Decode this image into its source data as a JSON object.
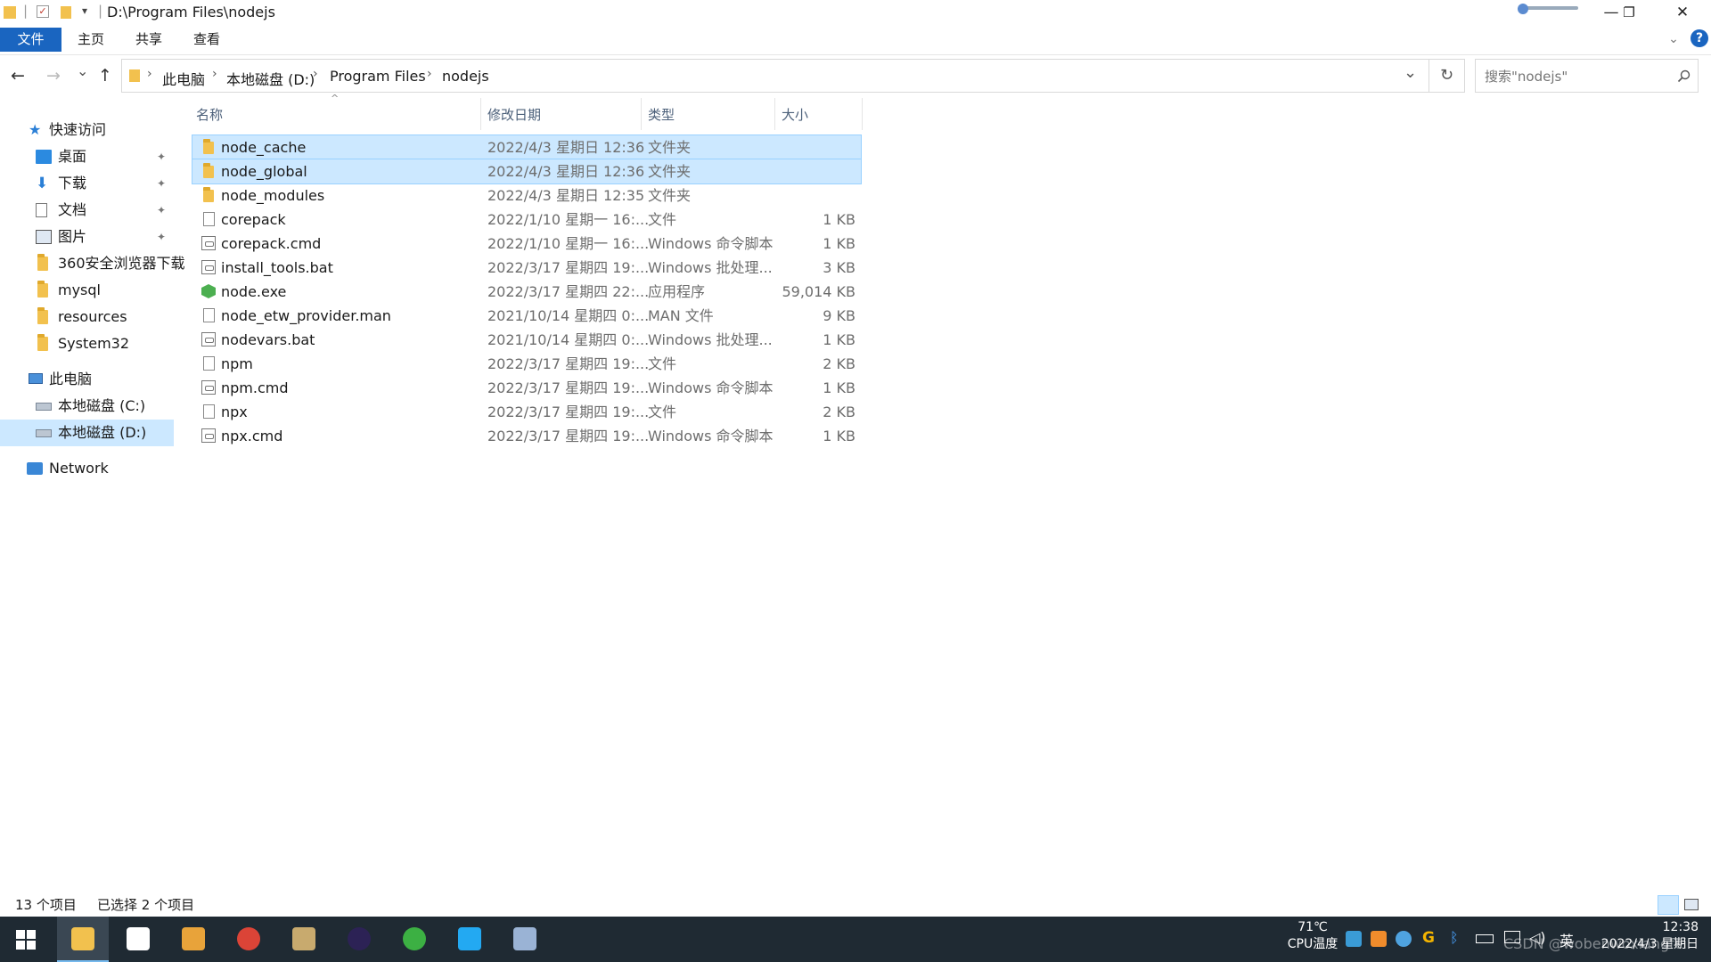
{
  "window": {
    "title": "D:\\Program Files\\nodejs",
    "controls": {
      "minimize": "—",
      "restore": "❐",
      "close": "✕"
    }
  },
  "ribbon": {
    "tabs": [
      "文件",
      "主页",
      "共享",
      "查看"
    ],
    "expand_icon": "chevron-down-icon",
    "help": "?"
  },
  "nav_buttons": {
    "back": "←",
    "forward": "→",
    "recent": "⌄",
    "up": "↑"
  },
  "address": {
    "crumbs": [
      "此电脑",
      "本地磁盘 (D:)",
      "Program Files",
      "nodejs"
    ],
    "separator": "›",
    "dropdown": "⌄",
    "refresh": "↻"
  },
  "search": {
    "placeholder": "搜索\"nodejs\"",
    "icon": "search-icon"
  },
  "navpane": {
    "quick_access": {
      "label": "快速访问",
      "items": [
        {
          "label": "桌面",
          "pinned": true,
          "icon": "desktop-icon"
        },
        {
          "label": "下载",
          "pinned": true,
          "icon": "download-icon"
        },
        {
          "label": "文档",
          "pinned": true,
          "icon": "document-icon"
        },
        {
          "label": "图片",
          "pinned": true,
          "icon": "pictures-icon"
        },
        {
          "label": "360安全浏览器下载",
          "pinned": false,
          "icon": "folder-icon"
        },
        {
          "label": "mysql",
          "pinned": false,
          "icon": "folder-icon"
        },
        {
          "label": "resources",
          "pinned": false,
          "icon": "folder-icon"
        },
        {
          "label": "System32",
          "pinned": false,
          "icon": "folder-icon"
        }
      ]
    },
    "this_pc": {
      "label": "此电脑",
      "items": [
        {
          "label": "本地磁盘 (C:)",
          "selected": false
        },
        {
          "label": "本地磁盘 (D:)",
          "selected": true
        }
      ]
    },
    "network": {
      "label": "Network"
    },
    "pin_glyph": "📌"
  },
  "columns": {
    "name": "名称",
    "date": "修改日期",
    "type": "类型",
    "size": "大小"
  },
  "files": [
    {
      "name": "node_cache",
      "date": "2022/4/3 星期日 12:36",
      "type": "文件夹",
      "size": "",
      "icon": "folder",
      "selected": true
    },
    {
      "name": "node_global",
      "date": "2022/4/3 星期日 12:36",
      "type": "文件夹",
      "size": "",
      "icon": "folder",
      "selected": true
    },
    {
      "name": "node_modules",
      "date": "2022/4/3 星期日 12:35",
      "type": "文件夹",
      "size": "",
      "icon": "folder",
      "selected": false
    },
    {
      "name": "corepack",
      "date": "2022/1/10 星期一 16:...",
      "type": "文件",
      "size": "1 KB",
      "icon": "file",
      "selected": false
    },
    {
      "name": "corepack.cmd",
      "date": "2022/1/10 星期一 16:...",
      "type": "Windows 命令脚本",
      "size": "1 KB",
      "icon": "cmd",
      "selected": false
    },
    {
      "name": "install_tools.bat",
      "date": "2022/3/17 星期四 19:...",
      "type": "Windows 批处理...",
      "size": "3 KB",
      "icon": "cmd",
      "selected": false
    },
    {
      "name": "node.exe",
      "date": "2022/3/17 星期四 22:...",
      "type": "应用程序",
      "size": "59,014 KB",
      "icon": "exe",
      "selected": false
    },
    {
      "name": "node_etw_provider.man",
      "date": "2021/10/14 星期四 0:...",
      "type": "MAN 文件",
      "size": "9 KB",
      "icon": "file",
      "selected": false
    },
    {
      "name": "nodevars.bat",
      "date": "2021/10/14 星期四 0:...",
      "type": "Windows 批处理...",
      "size": "1 KB",
      "icon": "cmd",
      "selected": false
    },
    {
      "name": "npm",
      "date": "2022/3/17 星期四 19:...",
      "type": "文件",
      "size": "2 KB",
      "icon": "file",
      "selected": false
    },
    {
      "name": "npm.cmd",
      "date": "2022/3/17 星期四 19:...",
      "type": "Windows 命令脚本",
      "size": "1 KB",
      "icon": "cmd",
      "selected": false
    },
    {
      "name": "npx",
      "date": "2022/3/17 星期四 19:...",
      "type": "文件",
      "size": "2 KB",
      "icon": "file",
      "selected": false
    },
    {
      "name": "npx.cmd",
      "date": "2022/3/17 星期四 19:...",
      "type": "Windows 命令脚本",
      "size": "1 KB",
      "icon": "cmd",
      "selected": false
    }
  ],
  "status": {
    "item_count": "13 个项目",
    "selected_count": "已选择 2 个项目"
  },
  "taskbar": {
    "apps": [
      {
        "name": "file-explorer",
        "color": "#f2c14e",
        "active": true
      },
      {
        "name": "microsoft-store",
        "color": "#ffffff",
        "active": false
      },
      {
        "name": "app-g",
        "color": "#e8a33a",
        "active": false
      },
      {
        "name": "chrome",
        "color": "#db4437",
        "active": false
      },
      {
        "name": "league",
        "color": "#c8aa6e",
        "active": false
      },
      {
        "name": "eclipse",
        "color": "#2c2255",
        "active": false
      },
      {
        "name": "360-browser",
        "color": "#3cb043",
        "active": false
      },
      {
        "name": "vscode",
        "color": "#23a9f2",
        "active": false
      },
      {
        "name": "paint",
        "color": "#9ab3d5",
        "active": false
      }
    ],
    "temp": "71℃",
    "temp_label": "CPU温度",
    "ime": "英",
    "time": "12:38",
    "date": "2022/4/3 星期日",
    "watermark": "CSDN @wobenwoxiangfei"
  },
  "colors": {
    "accent": "#1a65c0",
    "selection": "#cce8ff",
    "selection_border": "#99d1ff",
    "taskbar": "#1f2a33"
  }
}
